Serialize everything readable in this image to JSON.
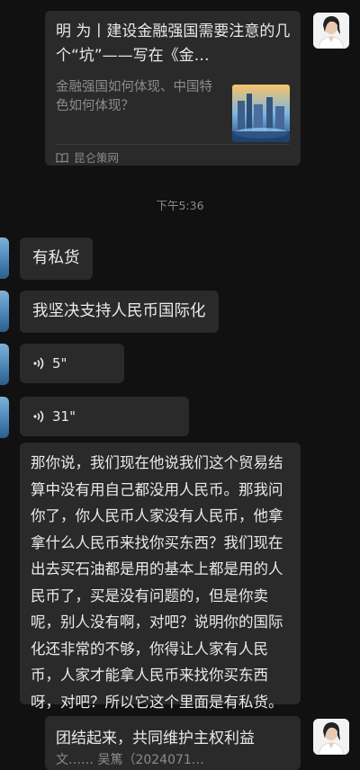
{
  "card": {
    "title": "明 为丨建设金融强国需要注意的几个“坑”——写在《金…",
    "description": "金融强国如何体现、中国特色如何体现？",
    "source": "昆仑策网"
  },
  "timestamp": "下午5:36",
  "messages": [
    {
      "type": "text",
      "text": "有私货"
    },
    {
      "type": "text",
      "text": "我坚决支持人民币国际化"
    },
    {
      "type": "voice",
      "duration": "5\""
    },
    {
      "type": "voice",
      "duration": "31\""
    },
    {
      "type": "text",
      "text": "那你说，我们现在他说我们这个贸易结算中没有用自己都没用人民币。那我问你了，你人民币人家没有人民币，他拿拿什么人民币来找你买东西？我们现在出去买石油都是用的基本上都是用的人民币了，买是没有问题的，但是你卖呢，别人没有啊，对吧？说明你的国际化还非常的不够，你得让人家有人民币，人家才能拿人民币来找你买东西呀，对吧？所以它这个里面是有私货。"
    }
  ],
  "bottom_message": {
    "text": "团结起来，共同维护主权利益",
    "subtext": "文…… 吴篤（2024071…"
  }
}
